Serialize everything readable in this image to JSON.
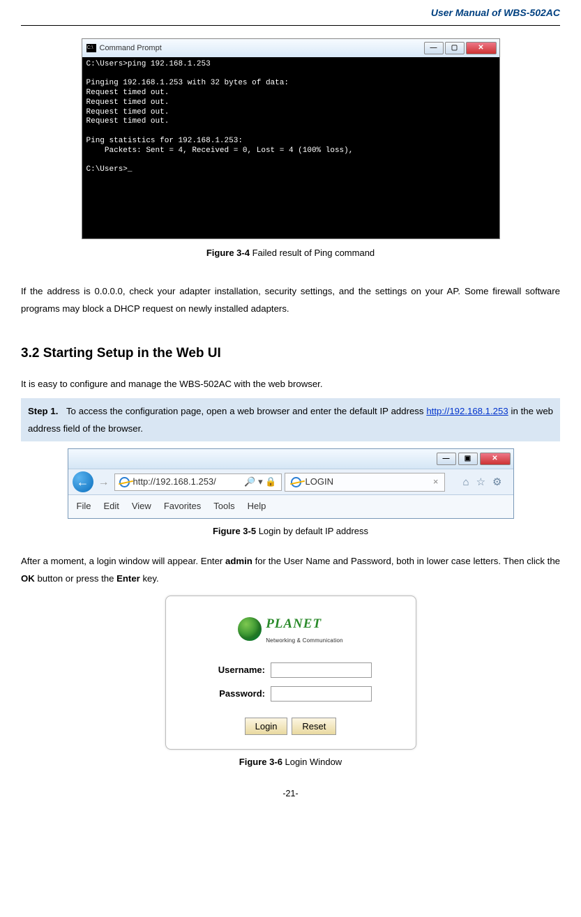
{
  "header": {
    "title": "User  Manual  of  WBS-502AC"
  },
  "cmd": {
    "title": "Command Prompt",
    "body": "C:\\Users>ping 192.168.1.253\n\nPinging 192.168.1.253 with 32 bytes of data:\nRequest timed out.\nRequest timed out.\nRequest timed out.\nRequest timed out.\n\nPing statistics for 192.168.1.253:\n    Packets: Sent = 4, Received = 0, Lost = 4 (100% loss),\n\nC:\\Users>_"
  },
  "figures": {
    "f34": {
      "label": "Figure 3-4",
      "text": " Failed result of Ping command"
    },
    "f35": {
      "label": "Figure 3-5",
      "text": " Login by default IP address"
    },
    "f36": {
      "label": "Figure 3-6",
      "text": " Login Window"
    }
  },
  "paragraphs": {
    "p1": "If the address is 0.0.0.0, check your adapter installation, security settings, and the settings on your AP. Some firewall software programs may block a DHCP request on newly installed adapters.",
    "p2": "It is easy to configure and manage the WBS-502AC with the web browser.",
    "p3a": "After a moment, a login window will appear. Enter ",
    "p3_bold1": "admin",
    "p3b": " for the User Name and Password, both in lower case letters. Then click the ",
    "p3_bold2": "OK",
    "p3c": " button or press the ",
    "p3_bold3": "Enter",
    "p3d": " key."
  },
  "section": {
    "heading": "3.2  Starting Setup in the Web UI"
  },
  "step1": {
    "label": "Step 1.",
    "text_a": "To access the configuration page, open a web browser and enter the default IP address ",
    "link": "http://192.168.1.253",
    "text_b": " in the web address field of the browser."
  },
  "ie": {
    "url": "http://192.168.1.253/",
    "search_hint": "🔍 ▾ 🔒",
    "tab": "LOGIN",
    "menu": [
      "File",
      "Edit",
      "View",
      "Favorites",
      "Tools",
      "Help"
    ]
  },
  "login": {
    "brand": "PLANET",
    "brand_sub": "Networking & Communication",
    "username_label": "Username:",
    "password_label": "Password:",
    "login_btn": "Login",
    "reset_btn": "Reset"
  },
  "page_num": "-21-"
}
